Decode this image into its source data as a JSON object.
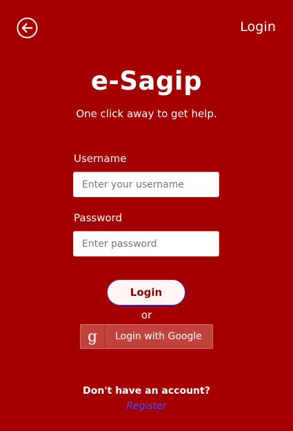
{
  "header": {
    "title": "Login",
    "back_icon": "arrow-left-circle-icon"
  },
  "app": {
    "title": "e-Sagip",
    "tagline": "One click away to get help."
  },
  "form": {
    "username_label": "Username",
    "username_placeholder": "Enter your username",
    "username_value": "",
    "password_label": "Password",
    "password_placeholder": "Enter password",
    "password_value": "",
    "login_button": "Login",
    "or_text": "or",
    "google_button": "Login with Google",
    "google_icon": "google-g-icon"
  },
  "footer": {
    "prompt": "Don't have an account?",
    "register_link": "Register"
  },
  "colors": {
    "background": "#a50000",
    "google_button": "#c1413c",
    "link": "#4a4cff"
  }
}
